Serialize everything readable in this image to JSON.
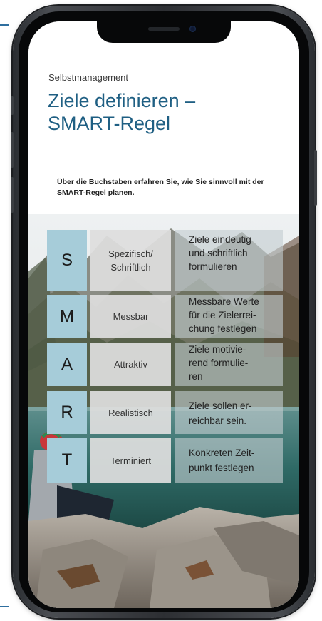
{
  "header": {
    "subtitle": "Selbstmanagement",
    "title_line1": "Ziele definieren –",
    "title_line2": "SMART-Regel"
  },
  "intro": {
    "text": "Über die Buchstaben erfahren Sie, wie Sie sinnvoll mit der SMART-Regel planen."
  },
  "smart": {
    "rows": [
      {
        "letter": "S",
        "term_line1": "Spezifisch/",
        "term_line2": "Schriftlich",
        "desc_line1": "Ziele eindeutig",
        "desc_line2": "und schriftlich",
        "desc_line3": "formulieren"
      },
      {
        "letter": "M",
        "term_line1": "Messbar",
        "term_line2": "",
        "desc_line1": "Messbare Werte",
        "desc_line2": "für die Zielerrei-",
        "desc_line3": "chung festlegen"
      },
      {
        "letter": "A",
        "term_line1": "Attraktiv",
        "term_line2": "",
        "desc_line1": "Ziele motivie-",
        "desc_line2": "rend formulie-",
        "desc_line3": "ren"
      },
      {
        "letter": "R",
        "term_line1": "Realistisch",
        "term_line2": "",
        "desc_line1": "Ziele sollen er-",
        "desc_line2": "reichbar sein.",
        "desc_line3": ""
      },
      {
        "letter": "T",
        "term_line1": "Terminiert",
        "term_line2": "",
        "desc_line1": "Konkreten Zeit-",
        "desc_line2": "punkt festlegen",
        "desc_line3": ""
      }
    ]
  },
  "colors": {
    "title": "#1f5f83",
    "letter_cell": "#a6ccd9",
    "term_cell": "#dedede",
    "accent": "#2f6f9f"
  },
  "icons": {
    "front_camera": "camera-dot",
    "earpiece": "speaker-slot"
  }
}
